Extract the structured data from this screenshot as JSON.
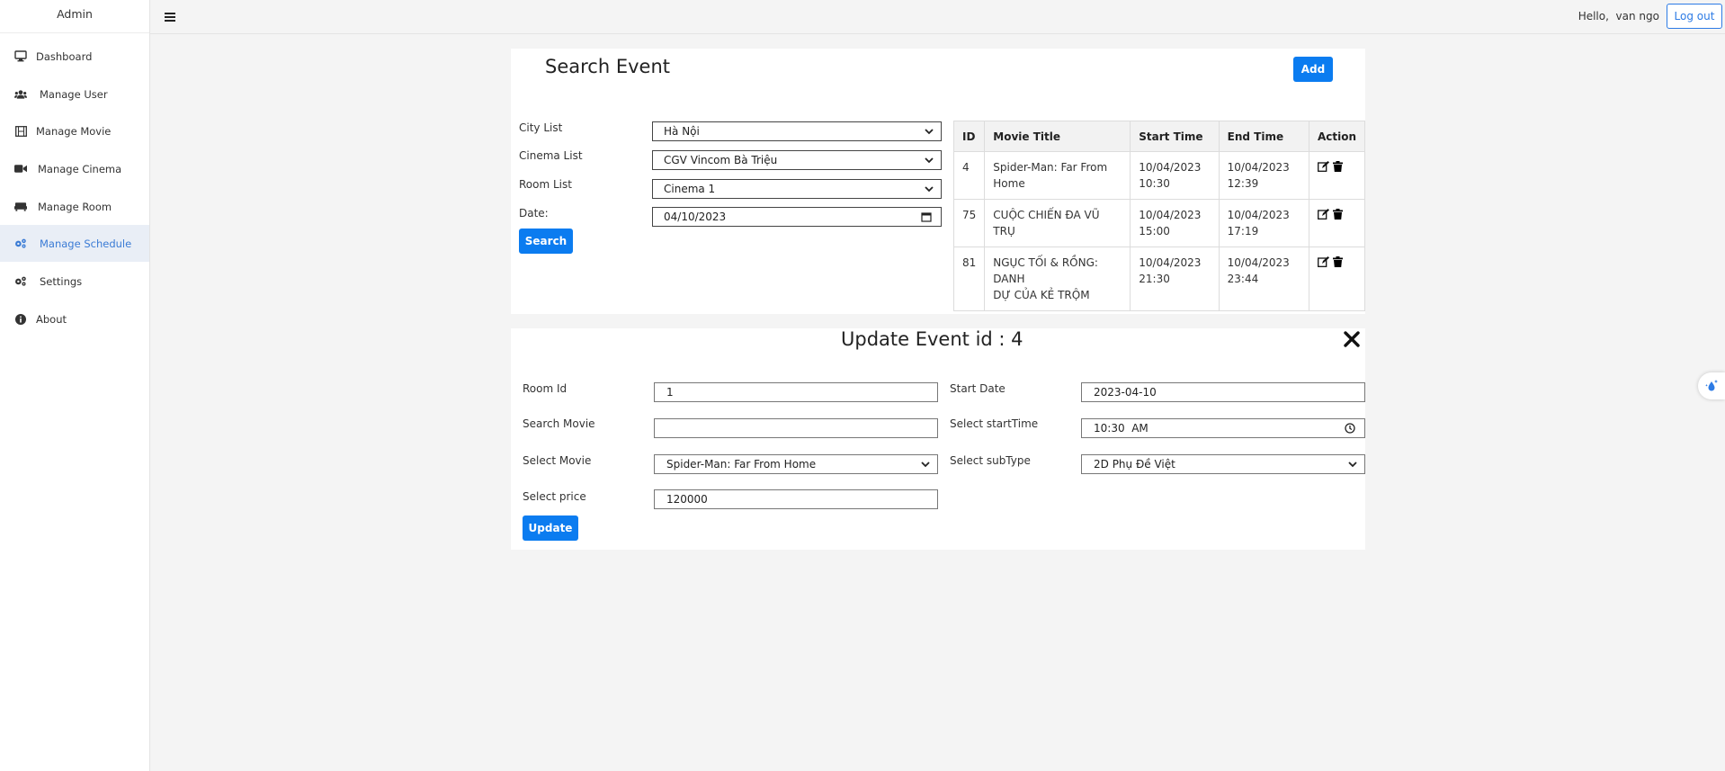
{
  "sidebar": {
    "brand": "Admin",
    "items": [
      {
        "label": "Dashboard",
        "icon": "desktop-icon"
      },
      {
        "label": "Manage User",
        "icon": "users-icon"
      },
      {
        "label": "Manage Movie",
        "icon": "film-icon"
      },
      {
        "label": "Manage Cinema",
        "icon": "video-camera-icon"
      },
      {
        "label": "Manage Room",
        "icon": "couch-icon"
      },
      {
        "label": "Manage Schedule",
        "icon": "cogs-icon",
        "active": true
      },
      {
        "label": "Settings",
        "icon": "gears-icon"
      },
      {
        "label": "About",
        "icon": "info-circle-icon"
      }
    ]
  },
  "topbar": {
    "greeting": "Hello,  van ngo",
    "logout_label": "Log out"
  },
  "search": {
    "title": "Search Event",
    "add_label": "Add",
    "city_label": "City List",
    "city_value": "Hà Nội",
    "cinema_label": "Cinema List",
    "cinema_value": "CGV Vincom Bà Triệu",
    "room_label": "Room List",
    "room_value": "Cinema 1",
    "date_label": "Date:",
    "date_value": "04/10/2023",
    "search_label": "Search"
  },
  "events_table": {
    "headers": [
      "ID",
      "Movie Title",
      "Start Time",
      "End Time",
      "Action"
    ],
    "rows": [
      {
        "id": "4",
        "title_1": "Spider-Man: Far From",
        "title_2": "Home",
        "start_1": "10/04/2023",
        "start_2": "10:30",
        "end_1": "10/04/2023",
        "end_2": "12:39"
      },
      {
        "id": "75",
        "title_1": "CUỘC CHIẾN ĐA VŨ TRỤ",
        "title_2": "",
        "start_1": "10/04/2023",
        "start_2": "15:00",
        "end_1": "10/04/2023",
        "end_2": "17:19"
      },
      {
        "id": "81",
        "title_1": "NGỤC TỐI & RỒNG: DANH",
        "title_2": "DỰ CỦA KẺ TRỘM",
        "start_1": "10/04/2023",
        "start_2": "21:30",
        "end_1": "10/04/2023",
        "end_2": "23:44"
      }
    ]
  },
  "update": {
    "title": "Update Event id : 4",
    "room_id_label": "Room Id",
    "room_id_value": "1",
    "search_movie_label": "Search Movie",
    "search_movie_value": "",
    "select_movie_label": "Select Movie",
    "select_movie_value": "Spider-Man: Far From Home",
    "price_label": "Select price",
    "price_value": "120000",
    "start_date_label": "Start Date",
    "start_date_value": "2023-04-10",
    "start_time_label": "Select startTime",
    "start_time_value": "10:30  AM",
    "subtype_label": "Select subType",
    "subtype_value": "2D Phụ Đề Việt",
    "update_label": "Update"
  }
}
